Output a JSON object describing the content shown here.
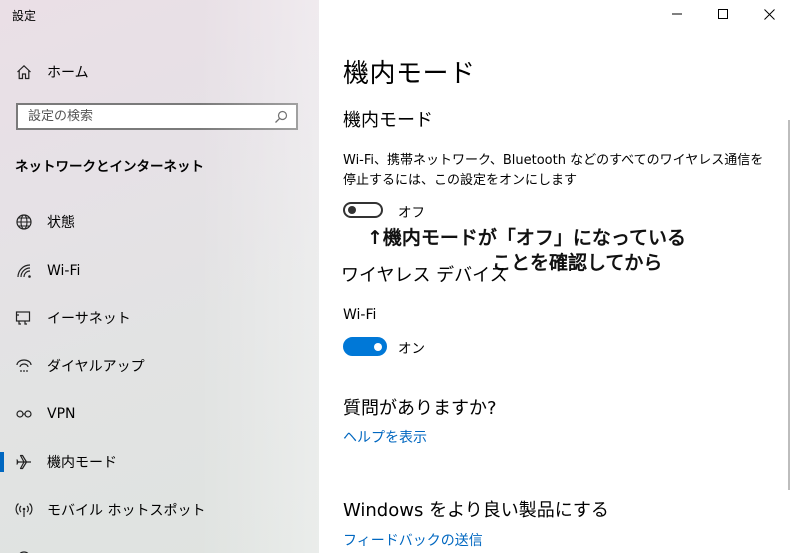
{
  "window": {
    "title": "設定"
  },
  "sidebar": {
    "home_label": "ホーム",
    "search_placeholder": "設定の検索",
    "section_title": "ネットワークとインターネット",
    "items": [
      {
        "label": "状態",
        "icon": "globe-icon"
      },
      {
        "label": "Wi-Fi",
        "icon": "wifi-icon"
      },
      {
        "label": "イーサネット",
        "icon": "ethernet-icon"
      },
      {
        "label": "ダイヤルアップ",
        "icon": "dialup-icon"
      },
      {
        "label": "VPN",
        "icon": "vpn-icon"
      },
      {
        "label": "機内モード",
        "icon": "airplane-icon",
        "active": true
      },
      {
        "label": "モバイル ホットスポット",
        "icon": "hotspot-icon"
      }
    ]
  },
  "main": {
    "page_title": "機内モード",
    "airplane_section_title": "機内モード",
    "airplane_description": "Wi-Fi、携帯ネットワーク、Bluetooth などのすべてのワイヤレス通信を停止するには、この設定をオンにします",
    "airplane_toggle": {
      "state": "off",
      "label": "オフ"
    },
    "annotation_line1": "↑機内モードが「オフ」になっている",
    "annotation_line2": "ことを確認してから",
    "wireless_section_title": "ワイヤレス デバイス",
    "wifi_label": "Wi-Fi",
    "wifi_toggle": {
      "state": "on",
      "label": "オン"
    },
    "question_title": "質問がありますか?",
    "help_link": "ヘルプを表示",
    "windows_title": "Windows をより良い製品にする",
    "feedback_link": "フィードバックの送信"
  },
  "colors": {
    "accent": "#0078d7",
    "link": "#0067c0"
  }
}
